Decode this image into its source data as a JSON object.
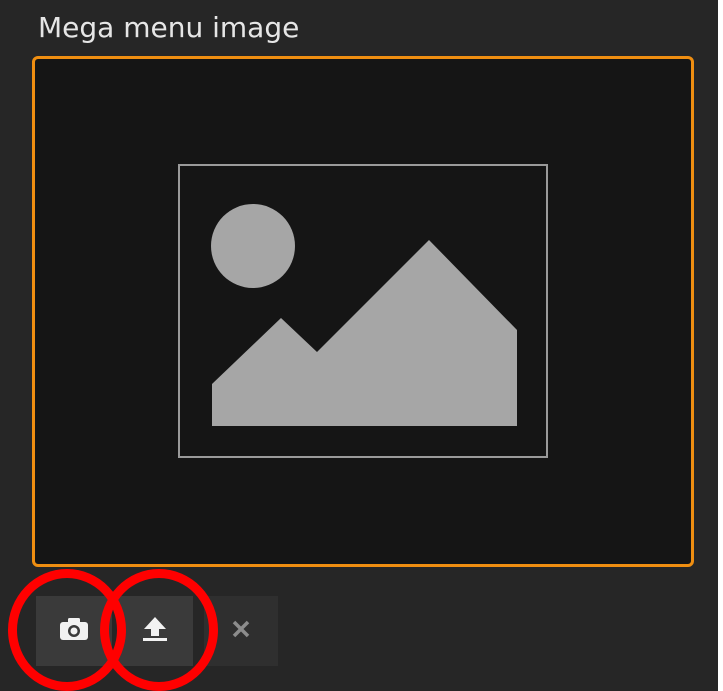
{
  "field": {
    "label": "Mega menu image"
  },
  "preview": {
    "placeholder_icon": "image-placeholder-icon",
    "accent_color": "#ef8e11"
  },
  "toolbar": {
    "camera_icon": "camera-icon",
    "upload_icon": "upload-icon",
    "remove_icon": "close-icon"
  },
  "annotations": {
    "highlight_color": "#ff0000"
  }
}
